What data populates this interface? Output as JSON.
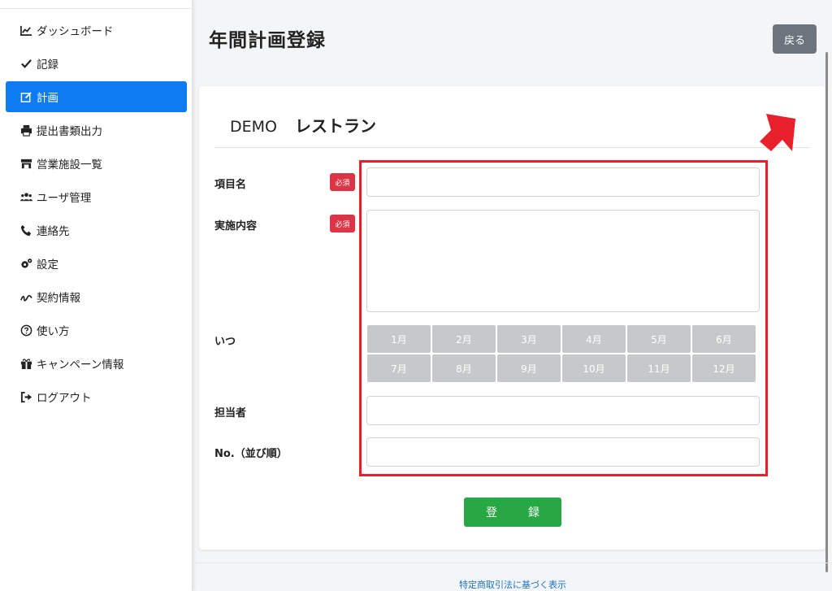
{
  "sidebar": {
    "items": [
      {
        "label": "ダッシュボード",
        "icon": "chart-line-icon"
      },
      {
        "label": "記録",
        "icon": "check-icon"
      },
      {
        "label": "計画",
        "icon": "edit-icon",
        "active": true
      },
      {
        "label": "提出書類出力",
        "icon": "print-icon"
      },
      {
        "label": "営業施設一覧",
        "icon": "store-icon"
      },
      {
        "label": "ユーザ管理",
        "icon": "users-icon"
      },
      {
        "label": "連絡先",
        "icon": "phone-icon"
      },
      {
        "label": "設定",
        "icon": "cogs-icon"
      },
      {
        "label": "契約情報",
        "icon": "signature-icon"
      },
      {
        "label": "使い方",
        "icon": "question-circle-icon"
      },
      {
        "label": "キャンペーン情報",
        "icon": "gift-icon"
      },
      {
        "label": "ログアウト",
        "icon": "sign-out-icon"
      }
    ]
  },
  "header": {
    "title": "年間計画登録",
    "back_label": "戻る"
  },
  "form": {
    "shop_prefix": "DEMO",
    "shop_name": "レストラン",
    "required_badge": "必須",
    "fields": {
      "item_name_label": "項目名",
      "content_label": "実施内容",
      "when_label": "いつ",
      "person_label": "担当者",
      "order_label": "No.（並び順）"
    },
    "months": [
      "1月",
      "2月",
      "3月",
      "4月",
      "5月",
      "6月",
      "7月",
      "8月",
      "9月",
      "10月",
      "11月",
      "12月"
    ],
    "submit_label": "登　録"
  },
  "footer": {
    "link": "特定商取引法に基づく表示"
  },
  "colors": {
    "active": "#0d7cf2",
    "required": "#dc3545",
    "submit": "#28a745",
    "highlight": "#e8202c",
    "month_button": "#c6c8ca"
  }
}
